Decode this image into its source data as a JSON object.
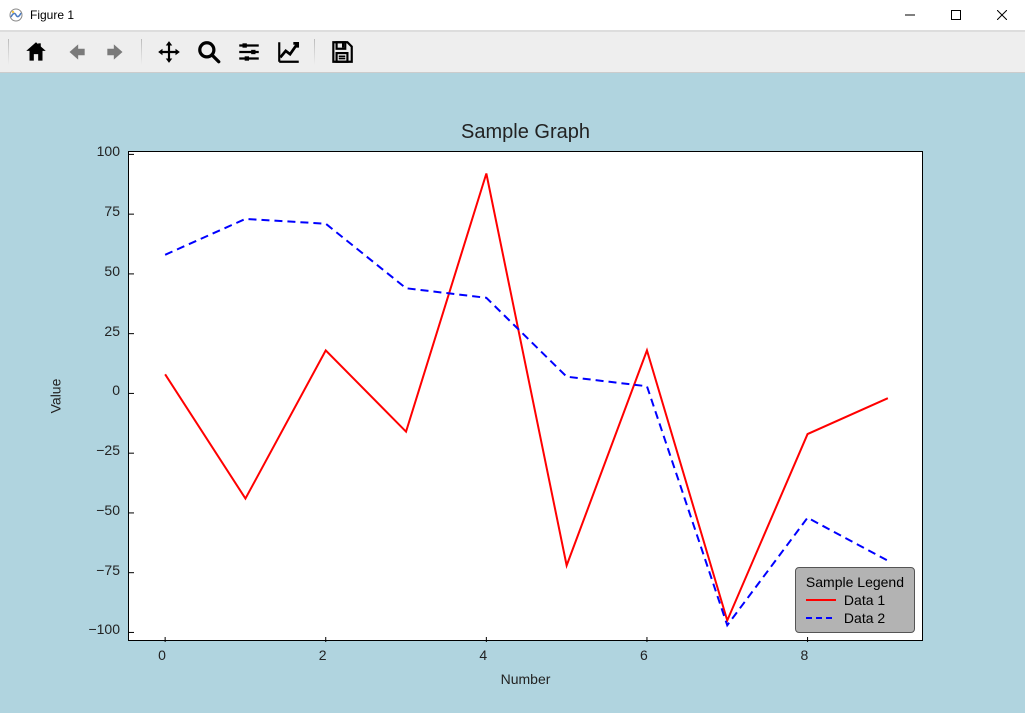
{
  "window": {
    "title": "Figure 1"
  },
  "toolbar": {
    "home": "Home",
    "back": "Back",
    "forward": "Forward",
    "pan": "Pan",
    "zoom": "Zoom",
    "subplots": "Configure subplots",
    "axes": "Edit axis",
    "save": "Save"
  },
  "chart_data": {
    "type": "line",
    "title": "Sample Graph",
    "xlabel": "Number",
    "ylabel": "Value",
    "x": [
      0,
      1,
      2,
      3,
      4,
      5,
      6,
      7,
      8,
      9
    ],
    "xlim": [
      -0.45,
      9.45
    ],
    "ylim": [
      -104,
      101
    ],
    "xticks": [
      0,
      2,
      4,
      6,
      8
    ],
    "yticks": [
      -100,
      -75,
      -50,
      -25,
      0,
      25,
      50,
      75,
      100
    ],
    "series": [
      {
        "name": "Data 1",
        "style": "solid",
        "color": "#ff0000",
        "values": [
          8,
          -44,
          18,
          -16,
          92,
          -72,
          18,
          -95,
          -17,
          -2
        ]
      },
      {
        "name": "Data 2",
        "style": "dashed",
        "color": "#0000ff",
        "values": [
          58,
          73,
          71,
          44,
          40,
          7,
          3,
          -97,
          -52,
          -70
        ]
      }
    ],
    "legend_title": "Sample Legend"
  },
  "colors": {
    "figure_bg": "#b0d4df",
    "axes_bg": "#ffffff"
  }
}
